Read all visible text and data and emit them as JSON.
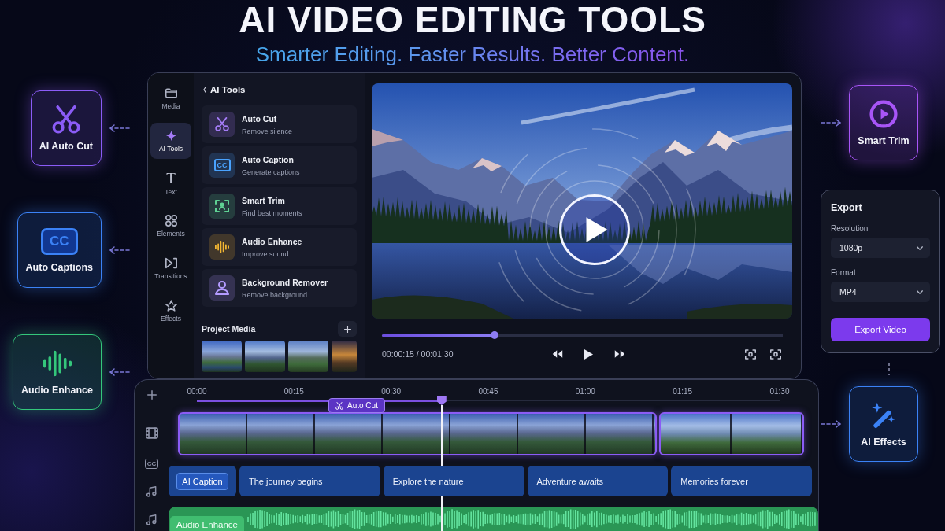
{
  "title": "AI VIDEO EDITING TOOLS",
  "subtitle": "Smarter Editing. Faster Results. Better Content.",
  "left_features": [
    {
      "label": "AI Auto Cut",
      "color": "#8b5cf6"
    },
    {
      "label": "Auto Captions",
      "color": "#3b82f6",
      "symbol": "CC"
    },
    {
      "label": "Audio Enhance",
      "color": "#34c77b"
    }
  ],
  "editor": {
    "nav": [
      {
        "label": "Media",
        "selected": false
      },
      {
        "label": "AI Tools",
        "selected": true
      },
      {
        "label": "Text",
        "selected": false,
        "symbol": "T"
      },
      {
        "label": "Elements",
        "selected": false
      },
      {
        "label": "Transitions",
        "selected": false
      },
      {
        "label": "Effects",
        "selected": false
      }
    ],
    "tools_panel": {
      "title": "AI Tools",
      "tools": [
        {
          "title": "Auto Cut",
          "subtitle": "Remove silence",
          "color": "#a47cf6"
        },
        {
          "title": "Auto Caption",
          "subtitle": "Generate captions",
          "color": "#4aa3ff",
          "symbol": "CC"
        },
        {
          "title": "Smart Trim",
          "subtitle": "Find best moments",
          "color": "#5fd394"
        },
        {
          "title": "Audio Enhance",
          "subtitle": "Improve sound",
          "color": "#f2b632"
        },
        {
          "title": "Background Remover",
          "subtitle": "Remove background",
          "color": "#b49bff"
        }
      ]
    },
    "project_media": {
      "title": "Project Media"
    },
    "player": {
      "progress": {
        "level": 0.28
      },
      "time": "00:00:15 / 00:01:30"
    }
  },
  "right_column": [
    {
      "kind": "feature",
      "label": "Smart Trim",
      "color": "#a855f7"
    },
    {
      "kind": "export",
      "title": "Export",
      "fields": [
        {
          "label": "Resolution",
          "value": "1080p"
        },
        {
          "label": "Format",
          "value": "MP4"
        }
      ],
      "button": "Export Video"
    },
    {
      "kind": "feature",
      "label": "AI Effects",
      "color": "#3b82f6"
    }
  ],
  "timeline": {
    "ticks": [
      "00:00",
      "00:15",
      "00:30",
      "00:45",
      "01:00",
      "01:15",
      "01:30"
    ],
    "playhead": {
      "level": 0.42
    },
    "clip_tag": "Auto Cut",
    "caption_symbol": "CC",
    "caption_track": {
      "label": "AI Caption",
      "captions": [
        "The journey begins",
        "Explore the nature",
        "Adventure awaits",
        "Memories forever"
      ]
    },
    "audio_track": {
      "label": "Audio Enhance"
    }
  }
}
